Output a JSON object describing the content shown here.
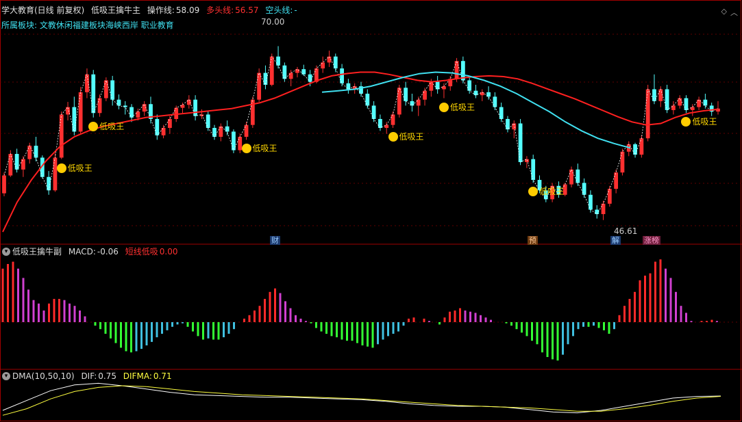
{
  "main_header": {
    "title": "学大教育(日线 前复权)",
    "indicator": "低吸王擒牛主",
    "op_label": "操作线:",
    "op_value": "58.09",
    "long_label": "多头线:",
    "long_value": "56.57",
    "short_label": "空头线:",
    "short_value": "-"
  },
  "sector_line": "所属板块: 文教休闲福建板块海峡西岸 职业教育",
  "price_labels": {
    "high": "70.00",
    "low": "46.61"
  },
  "signal_label": "低吸王",
  "event_tags": [
    "财",
    "预",
    "解",
    "涨榜"
  ],
  "macd_header": {
    "name": "低吸王擒牛副",
    "macd_label": "MACD:",
    "macd_value": "-0.06",
    "signal_label": "短线低吸",
    "signal_value": "0.00"
  },
  "dma_header": {
    "name": "DMA(10,50,10)",
    "dif_label": "DIF:",
    "dif_value": "0.75",
    "difma_label": "DIFMA:",
    "difma_value": "0.71"
  },
  "colors": {
    "up": "#ff3030",
    "down": "#54ffff",
    "ma": "#ff2020",
    "ma_cyan": "#40e0f0",
    "label": "#ffd700",
    "macd_pos": "#ff2a2a",
    "macd_pos_fade": "#d040d0",
    "macd_neg": "#33ff33",
    "macd_neg_fade": "#40c0e0",
    "dma_dif": "#ffffff",
    "dma_difma": "#ffff40"
  },
  "chart_data": {
    "type": "candlestick",
    "y_range": [
      44,
      74
    ],
    "candles": [
      [
        50.2,
        53.0,
        49.8,
        52.6
      ],
      [
        52.6,
        56.0,
        52.4,
        55.5
      ],
      [
        55.5,
        56.2,
        53.0,
        53.4
      ],
      [
        53.4,
        55.2,
        52.4,
        54.8
      ],
      [
        54.8,
        57.0,
        54.2,
        56.6
      ],
      [
        56.6,
        57.8,
        54.5,
        55.0
      ],
      [
        55.0,
        55.3,
        52.2,
        52.4
      ],
      [
        52.4,
        53.2,
        50.0,
        50.6
      ],
      [
        50.6,
        55.6,
        50.4,
        55.0
      ],
      [
        55.0,
        61.2,
        54.8,
        60.8
      ],
      [
        60.8,
        62.5,
        60.0,
        61.8
      ],
      [
        61.8,
        63.2,
        58.0,
        58.5
      ],
      [
        58.5,
        64.5,
        58.2,
        63.8
      ],
      [
        63.8,
        67.0,
        63.0,
        66.2
      ],
      [
        66.2,
        66.8,
        60.4,
        61.0
      ],
      [
        61.0,
        63.5,
        60.5,
        63.0
      ],
      [
        63.0,
        65.8,
        62.6,
        65.4
      ],
      [
        65.4,
        66.0,
        62.0,
        62.8
      ],
      [
        62.8,
        63.5,
        61.5,
        62.0
      ],
      [
        62.0,
        62.6,
        60.8,
        61.8
      ],
      [
        61.8,
        62.2,
        59.8,
        60.4
      ],
      [
        60.4,
        61.6,
        60.0,
        61.2
      ],
      [
        61.2,
        62.6,
        60.6,
        62.2
      ],
      [
        62.2,
        63.2,
        59.6,
        60.2
      ],
      [
        60.2,
        60.8,
        57.4,
        58.0
      ],
      [
        58.0,
        59.4,
        57.6,
        59.0
      ],
      [
        59.0,
        60.6,
        58.2,
        60.2
      ],
      [
        60.2,
        62.0,
        59.8,
        61.7
      ],
      [
        61.7,
        62.4,
        61.0,
        62.1
      ],
      [
        62.1,
        63.4,
        61.6,
        62.8
      ],
      [
        62.8,
        63.4,
        60.0,
        60.6
      ],
      [
        60.6,
        61.5,
        60.2,
        60.8
      ],
      [
        60.8,
        61.2,
        58.6,
        59.0
      ],
      [
        59.0,
        59.4,
        57.4,
        57.8
      ],
      [
        57.8,
        59.6,
        57.2,
        59.2
      ],
      [
        59.2,
        60.0,
        58.0,
        58.5
      ],
      [
        58.5,
        58.8,
        55.6,
        56.0
      ],
      [
        56.0,
        58.2,
        55.6,
        57.8
      ],
      [
        57.8,
        59.8,
        57.4,
        59.4
      ],
      [
        59.4,
        63.2,
        59.0,
        62.8
      ],
      [
        62.8,
        67.0,
        62.5,
        66.4
      ],
      [
        66.4,
        67.4,
        64.2,
        64.8
      ],
      [
        64.8,
        69.0,
        64.6,
        68.6
      ],
      [
        68.6,
        70.0,
        67.0,
        67.4
      ],
      [
        67.4,
        67.8,
        65.2,
        65.6
      ],
      [
        65.6,
        66.8,
        64.6,
        66.4
      ],
      [
        66.4,
        67.2,
        65.8,
        66.9
      ],
      [
        66.9,
        67.5,
        66.0,
        66.2
      ],
      [
        66.2,
        66.8,
        64.6,
        65.2
      ],
      [
        65.2,
        67.4,
        65.0,
        67.0
      ],
      [
        67.0,
        68.6,
        66.4,
        67.8
      ],
      [
        67.8,
        69.4,
        67.2,
        68.6
      ],
      [
        68.6,
        69.0,
        66.5,
        67.0
      ],
      [
        67.0,
        67.6,
        64.6,
        65.0
      ],
      [
        65.0,
        65.6,
        63.6,
        64.2
      ],
      [
        64.2,
        65.0,
        63.6,
        64.6
      ],
      [
        64.6,
        65.2,
        63.2,
        63.6
      ],
      [
        63.6,
        64.2,
        61.6,
        62.0
      ],
      [
        62.0,
        62.6,
        59.8,
        60.2
      ],
      [
        60.2,
        60.8,
        58.6,
        59.0
      ],
      [
        59.0,
        59.8,
        58.2,
        59.4
      ],
      [
        59.4,
        61.2,
        59.0,
        60.8
      ],
      [
        60.8,
        64.8,
        60.4,
        64.4
      ],
      [
        64.4,
        65.2,
        62.0,
        62.6
      ],
      [
        62.6,
        63.6,
        61.2,
        62.0
      ],
      [
        62.0,
        63.2,
        60.6,
        62.8
      ],
      [
        62.8,
        64.4,
        62.0,
        64.0
      ],
      [
        64.0,
        65.6,
        63.2,
        65.2
      ],
      [
        65.2,
        66.0,
        63.6,
        64.2
      ],
      [
        64.2,
        65.0,
        63.0,
        64.6
      ],
      [
        64.6,
        66.0,
        64.0,
        65.6
      ],
      [
        65.6,
        68.4,
        65.2,
        68.0
      ],
      [
        68.0,
        68.6,
        65.0,
        65.4
      ],
      [
        65.4,
        66.0,
        63.6,
        64.0
      ],
      [
        64.0,
        64.8,
        63.0,
        63.4
      ],
      [
        63.4,
        64.2,
        62.6,
        63.8
      ],
      [
        63.8,
        64.6,
        62.8,
        63.2
      ],
      [
        63.2,
        63.8,
        61.4,
        61.8
      ],
      [
        61.8,
        62.4,
        59.8,
        60.2
      ],
      [
        60.2,
        60.6,
        58.4,
        58.8
      ],
      [
        58.8,
        60.0,
        57.6,
        59.6
      ],
      [
        59.6,
        60.2,
        54.0,
        54.4
      ],
      [
        54.4,
        55.2,
        53.6,
        54.8
      ],
      [
        54.8,
        55.4,
        51.6,
        52.0
      ],
      [
        52.0,
        52.6,
        50.2,
        50.6
      ],
      [
        50.6,
        51.2,
        49.0,
        49.4
      ],
      [
        49.4,
        51.6,
        49.0,
        51.2
      ],
      [
        51.2,
        51.8,
        49.6,
        50.0
      ],
      [
        50.0,
        51.6,
        49.8,
        51.4
      ],
      [
        51.4,
        53.8,
        51.0,
        53.4
      ],
      [
        53.4,
        54.2,
        51.2,
        51.6
      ],
      [
        51.6,
        52.2,
        49.6,
        50.0
      ],
      [
        50.0,
        50.6,
        47.6,
        48.0
      ],
      [
        48.0,
        48.6,
        46.8,
        47.4
      ],
      [
        47.4,
        49.2,
        46.6,
        48.8
      ],
      [
        48.8,
        51.2,
        48.4,
        50.8
      ],
      [
        50.8,
        53.4,
        50.2,
        53.0
      ],
      [
        53.0,
        56.2,
        52.6,
        55.8
      ],
      [
        55.8,
        57.2,
        55.2,
        56.8
      ],
      [
        56.8,
        57.0,
        55.0,
        55.4
      ],
      [
        55.4,
        58.0,
        55.0,
        57.6
      ],
      [
        57.6,
        64.8,
        57.2,
        64.2
      ],
      [
        64.2,
        66.2,
        62.2,
        62.6
      ],
      [
        62.6,
        64.6,
        61.8,
        64.2
      ],
      [
        64.2,
        64.8,
        61.0,
        61.4
      ],
      [
        61.4,
        62.6,
        60.8,
        62.0
      ],
      [
        62.0,
        63.4,
        61.6,
        63.0
      ],
      [
        63.0,
        63.4,
        61.0,
        61.4
      ],
      [
        61.4,
        62.2,
        60.6,
        61.8
      ],
      [
        61.8,
        63.2,
        61.4,
        62.8
      ],
      [
        62.8,
        63.6,
        61.6,
        62.0
      ],
      [
        62.0,
        62.4,
        60.6,
        61.2
      ],
      [
        61.2,
        62.6,
        60.8,
        61.6
      ]
    ],
    "ma_red": [
      45.0,
      49.0,
      52.0,
      54.5,
      56.5,
      57.8,
      58.6,
      59.2,
      59.6,
      60.0,
      60.4,
      60.6,
      60.8,
      61.0,
      61.2,
      61.4,
      61.6,
      62.0,
      62.4,
      63.0,
      63.8,
      64.6,
      65.4,
      66.0,
      66.3,
      66.5,
      66.5,
      66.2,
      65.8,
      65.4,
      65.2,
      65.4,
      65.7,
      65.9,
      66.0,
      65.9,
      65.6,
      65.0,
      64.3,
      63.6,
      62.9,
      62.1,
      61.3,
      60.5,
      59.8,
      59.4,
      59.6,
      60.4,
      61.0,
      61.3,
      61.5
    ],
    "ma_cyan": [
      63.8,
      64.0,
      64.2,
      64.6,
      65.2,
      65.8,
      66.3,
      66.5,
      66.4,
      66.0,
      65.4,
      64.6,
      63.6,
      62.4,
      61.2,
      59.8,
      58.6,
      57.6,
      56.9,
      56.3
    ],
    "macd_bars": [
      4.6,
      5.0,
      5.2,
      4.6,
      3.8,
      2.8,
      1.9,
      1.6,
      1.0,
      1.6,
      2.0,
      2.0,
      1.9,
      1.6,
      1.4,
      1.0,
      0.5,
      0.0,
      -0.3,
      -0.6,
      -1.0,
      -1.4,
      -1.8,
      -2.2,
      -2.5,
      -2.6,
      -2.5,
      -2.3,
      -2.0,
      -1.7,
      -1.3,
      -1.0,
      -0.7,
      -0.4,
      -0.2,
      -0.1,
      -0.4,
      -0.8,
      -1.2,
      -1.5,
      -1.4,
      -1.5,
      -1.5,
      -1.3,
      -1.0,
      -0.6,
      0.0,
      0.3,
      0.6,
      1.0,
      1.4,
      2.0,
      2.6,
      2.9,
      2.5,
      1.8,
      1.2,
      0.6,
      0.3,
      0.1,
      -0.1,
      -0.5,
      -0.8,
      -1.0,
      -1.2,
      -1.3,
      -1.5,
      -1.6,
      -1.6,
      -1.8,
      -2.0,
      -2.1,
      -2.2,
      -1.9,
      -1.5,
      -1.2,
      -1.0,
      -0.8,
      -0.3,
      0.3,
      0.4,
      0.0,
      0.3,
      0.1,
      0.0,
      -0.2,
      0.4,
      0.9,
      1.0,
      1.2,
      1.0,
      0.9,
      0.8,
      0.6,
      0.4,
      0.2,
      0.0,
      0.0,
      -0.1,
      -0.3,
      -0.6,
      -0.9,
      -1.2,
      -1.6,
      -1.9,
      -2.6,
      -3.0,
      -3.2,
      -3.3,
      -2.8,
      -1.9,
      -1.2,
      -0.6,
      -0.4,
      -0.4,
      -0.3,
      -0.5,
      -0.7,
      -1.0,
      -0.6,
      0.6,
      1.4,
      2.0,
      2.6,
      3.6,
      4.0,
      4.2,
      5.2,
      5.4,
      4.6,
      3.8,
      2.6,
      1.4,
      0.8,
      0.1,
      0.0,
      0.1,
      0.1,
      0.2,
      0.1,
      0.0
    ],
    "dma_dif": [
      -1.0,
      0.2,
      1.4,
      2.1,
      2.3,
      2.0,
      1.6,
      1.2,
      0.9,
      0.8,
      0.7,
      0.6,
      0.6,
      0.5,
      0.4,
      0.3,
      0.1,
      -0.2,
      -0.4,
      -0.5,
      -0.5,
      -0.6,
      -0.9,
      -1.2,
      -1.3,
      -1.0,
      -0.5,
      0.0,
      0.5,
      0.7,
      0.75
    ],
    "dma_difma": [
      -1.6,
      -0.8,
      0.4,
      1.3,
      1.8,
      2.0,
      1.9,
      1.6,
      1.3,
      1.1,
      0.9,
      0.8,
      0.7,
      0.6,
      0.5,
      0.4,
      0.2,
      0.0,
      -0.2,
      -0.4,
      -0.5,
      -0.6,
      -0.7,
      -0.9,
      -1.1,
      -1.1,
      -0.8,
      -0.4,
      0.1,
      0.5,
      0.71
    ]
  }
}
